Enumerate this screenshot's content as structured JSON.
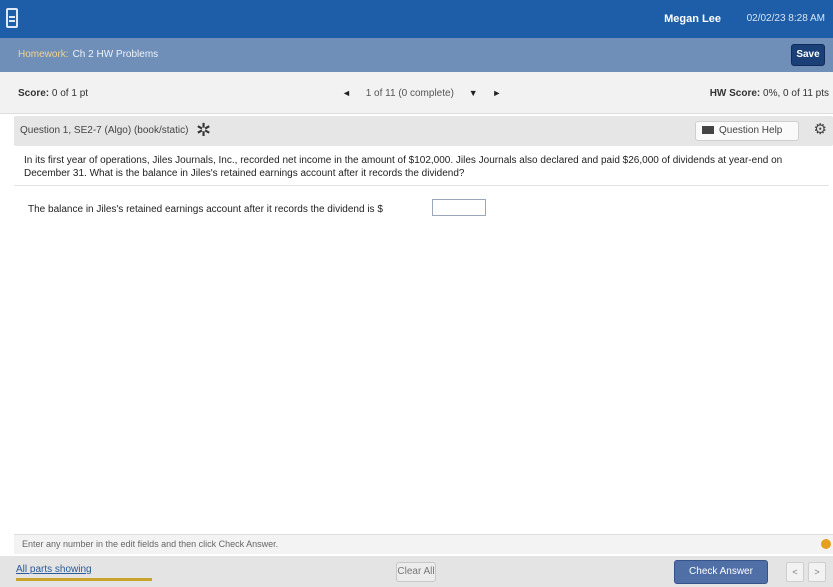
{
  "topbar": {
    "user_name": "Megan Lee",
    "datetime": "02/02/23 8:28 AM"
  },
  "assignment": {
    "homework_label": "Homework:",
    "homework_sub": "Ch 2 HW Problems",
    "save_label": "Save"
  },
  "scorebar": {
    "score_label": "Score:",
    "score_value": "0 of 1 pt",
    "nav_prev": "◄",
    "nav_status": "1 of 11 (0 complete)",
    "nav_dropdown": "▼",
    "nav_next": "►",
    "hw_score_label": "HW Score:",
    "hw_score_value": "0%, 0 of 11 pts"
  },
  "question": {
    "title": "Question 1, SE2-7 (Algo) (book/static)",
    "help_label": "Question Help",
    "prompt": "In its first year of operations, Jiles Journals, Inc., recorded net income in the amount of $102,000. Jiles Journals also declared and paid $26,000 of dividends at year-end on December 31. What is the balance in Jiles's retained earnings account after it records the dividend?",
    "answer_lead": "The balance in Jiles's retained earnings account after it records the dividend is $",
    "answer_value": ""
  },
  "footer": {
    "hint": "Enter any number in the edit fields and then click Check Answer.",
    "all_parts": "All parts showing",
    "clear_all": "Clear All",
    "check_answer": "Check Answer",
    "prev_arrow": "<",
    "next_arrow": ">"
  }
}
